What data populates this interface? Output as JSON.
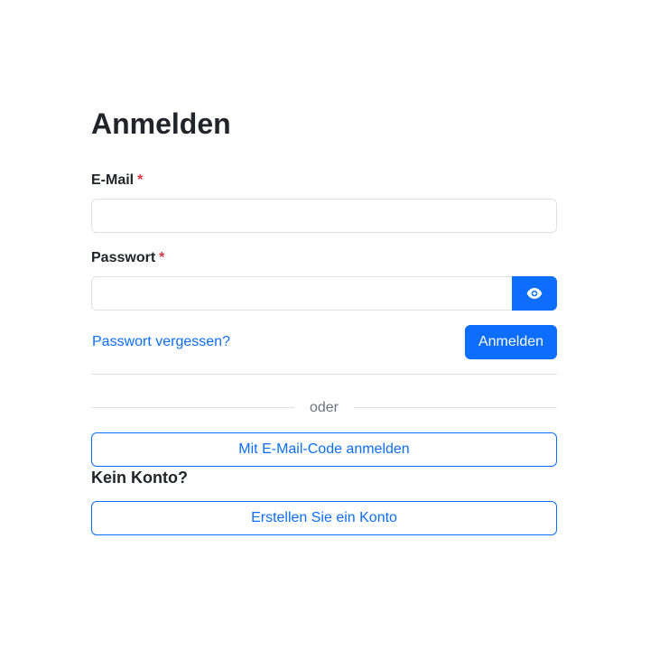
{
  "page": {
    "title": "Anmelden"
  },
  "form": {
    "email_label": "E-Mail",
    "email_value": "",
    "password_label": "Passwort",
    "password_value": "",
    "required_marker": "*",
    "show_password_icon": "eye-icon",
    "forgot_password_link": "Passwort vergessen?",
    "submit_label": "Anmelden"
  },
  "alternatives": {
    "separator_text": "oder",
    "email_code_button": "Mit E-Mail-Code anmelden",
    "no_account_heading": "Kein Konto?",
    "create_account_button": "Erstellen Sie ein Konto"
  },
  "colors": {
    "primary": "#0d6efd",
    "required": "#dc3545",
    "border": "#dee2e6",
    "muted": "#6c757d",
    "text": "#212529"
  }
}
